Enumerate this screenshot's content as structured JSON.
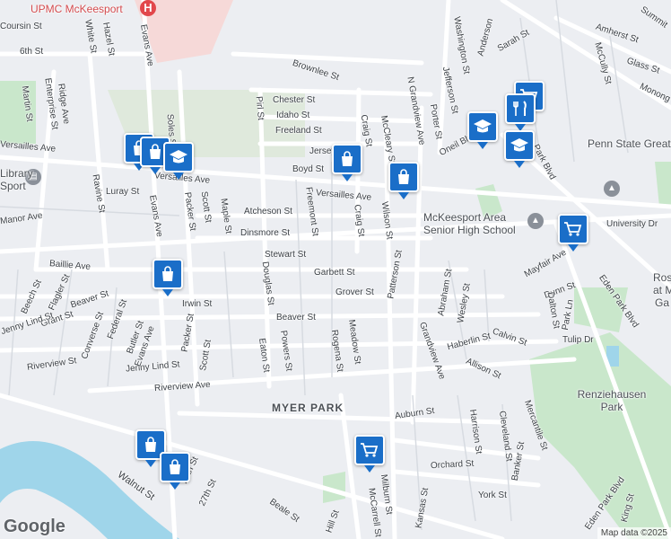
{
  "map": {
    "attribution": "Map data ©2025",
    "logo": "Google",
    "labels": {
      "upmc": "UPMC McKeesport",
      "coursin": "Coursin St",
      "sixth": "6th St",
      "white": "White St",
      "hazel": "Hazel St",
      "evansTop": "Evans Ave",
      "brownlee": "Brownlee St",
      "washington": "Washington St",
      "anderson": "Anderson",
      "sarah": "Sarah St",
      "summit": "Summit",
      "amherst": "Amherst St",
      "glass": "Glass St",
      "mccully": "McCully St",
      "monong": "Monong",
      "chester": "Chester St",
      "idaho": "Idaho St",
      "freeland": "Freeland St",
      "jersey": "Jersey",
      "boyd": "Boyd St",
      "pirl": "Pirl St",
      "craig": "Craig St",
      "mccleary": "McCleary St",
      "ngrandview": "N Grandview Ave",
      "jefferson": "Jefferson St",
      "porter": "Porter St",
      "oneil": "Oneil Blvd",
      "parkblvd": "Park Blvd",
      "martin": "Martin St",
      "ridge": "Ridge Ave",
      "enterprise": "Enterprise St",
      "soles": "Soles St",
      "pennstate": "Penn State Greater Allegheny",
      "library": "Library",
      "sport": "Sport",
      "versaillesW": "Versailles Ave",
      "versaillesE": "Versailles Ave",
      "luray": "Luray St",
      "ravine": "Ravine St",
      "manor": "Manor Ave",
      "evansMid": "Evans Ave",
      "packer": "Packer St",
      "scott": "Scott St",
      "maple": "Maple St",
      "atcheson": "Atcheson St",
      "dinsmore": "Dinsmore St",
      "freemont": "Freemont St",
      "craig2": "Craig St",
      "wilson": "Wilson St",
      "highschool": "McKeesport Area Senior High School",
      "university": "University Dr",
      "baillie": "Baillie Ave",
      "stewart": "Stewart St",
      "garbett": "Garbett St",
      "patterson": "Patterson St",
      "mayfair": "Mayfair Ave",
      "rose": "Ros",
      "atm": "at M",
      "ga": "Ga",
      "beech": "Beech St",
      "flagler": "Flagler St",
      "beaver": "Beaver St",
      "irwin": "Irwin St",
      "grover": "Grover St",
      "douglas": "Douglas St",
      "abraham": "Abraham St",
      "wesley": "Wesley St",
      "dunn": "Dunn St",
      "dalton": "Dalton St",
      "parkln": "Park Ln",
      "edenpark": "Eden Park Blvd",
      "grant": "Grant St",
      "federal": "Federal St",
      "converse": "Converse St",
      "butler": "Butler St",
      "powers": "Powers St",
      "beaver2": "Beaver St",
      "rogena": "Rogena St",
      "meadow": "Meadow St",
      "haberlin": "Haberlin St",
      "calvin": "Calvin St",
      "tulip": "Tulip Dr",
      "jennyW": "Jenny Lind St",
      "jennyMid": "Jenny Lind St",
      "eaton": "Eaton St",
      "grandview": "Grandview Ave",
      "allison": "Allison St",
      "renz": "Renziehausen Park",
      "riverview": "Riverview St",
      "riverviewAve": "Riverview Ave",
      "myer": "MYER PARK",
      "auburn": "Auburn St",
      "harrison": "Harrison St",
      "cleveland": "Cleveland St",
      "mercantile": "Mercantile St",
      "banker": "Banker St",
      "orchard": "Orchard St",
      "milburn": "Milburn St",
      "mccarrell": "McCarrell St",
      "kansas": "Kansas St",
      "york": "York St",
      "edenpark2": "Eden Park Blvd",
      "king": "King St",
      "walnut": "Walnut St",
      "twentyseventh": "27th St",
      "twentysixth": "26th St",
      "beale": "Beale St",
      "hill": "Hill St",
      "jenny3": "Jenny Lind St",
      "scott2": "Scott St",
      "packer2": "Packer St",
      "evans3": "Evans Ave"
    },
    "markers": [
      {
        "kind": "shopping",
        "icon": "shopping-bag-icon"
      },
      {
        "kind": "shopping",
        "icon": "shopping-bag-icon"
      },
      {
        "kind": "school",
        "icon": "graduation-cap-icon"
      },
      {
        "kind": "shopping",
        "icon": "shopping-bag-icon"
      },
      {
        "kind": "shopping",
        "icon": "shopping-bag-icon"
      },
      {
        "kind": "grocery",
        "icon": "shopping-cart-icon"
      },
      {
        "kind": "restaurant",
        "icon": "fork-knife-icon"
      },
      {
        "kind": "school",
        "icon": "graduation-cap-icon"
      },
      {
        "kind": "school",
        "icon": "graduation-cap-icon"
      },
      {
        "kind": "grocery",
        "icon": "shopping-cart-icon"
      },
      {
        "kind": "shopping",
        "icon": "shopping-bag-icon"
      },
      {
        "kind": "shopping",
        "icon": "shopping-bag-icon"
      },
      {
        "kind": "shopping",
        "icon": "shopping-bag-icon"
      },
      {
        "kind": "grocery",
        "icon": "shopping-cart-icon"
      }
    ],
    "colors": {
      "marker": "#1a6ec8",
      "park": "#c9e7cb",
      "river": "#9fd5ea",
      "hospital": "#e2474b",
      "land": "#eceef2",
      "road": "#ffffff"
    }
  }
}
